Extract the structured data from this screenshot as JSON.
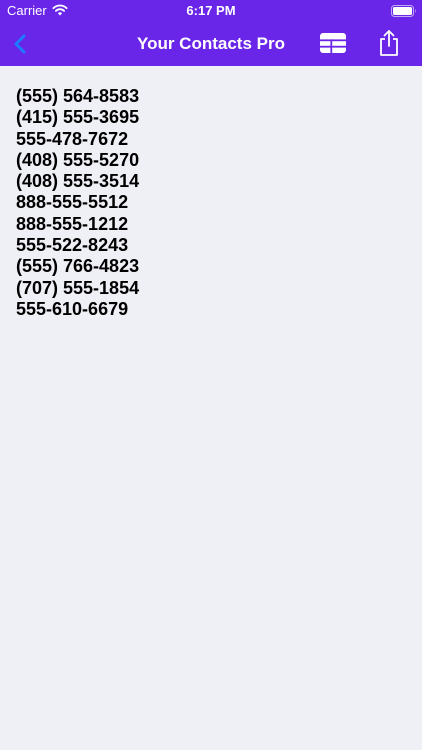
{
  "status_bar": {
    "carrier": "Carrier",
    "time": "6:17 PM",
    "wifi_icon": "wifi-icon",
    "battery_icon": "battery-icon"
  },
  "nav": {
    "title": "Your Contacts Pro",
    "back_icon": "chevron-left-icon",
    "grid_icon": "table-grid-icon",
    "share_icon": "share-icon"
  },
  "colors": {
    "header_background": "#6a26e8",
    "page_background": "#efeff6",
    "back_chevron": "#1a7cff",
    "text": "#000000"
  },
  "phone_numbers": [
    "(555) 564-8583",
    "(415) 555-3695",
    "555-478-7672",
    "(408) 555-5270",
    "(408) 555-3514",
    "888-555-5512",
    "888-555-1212",
    "555-522-8243",
    "(555) 766-4823",
    "(707) 555-1854",
    "555-610-6679"
  ]
}
